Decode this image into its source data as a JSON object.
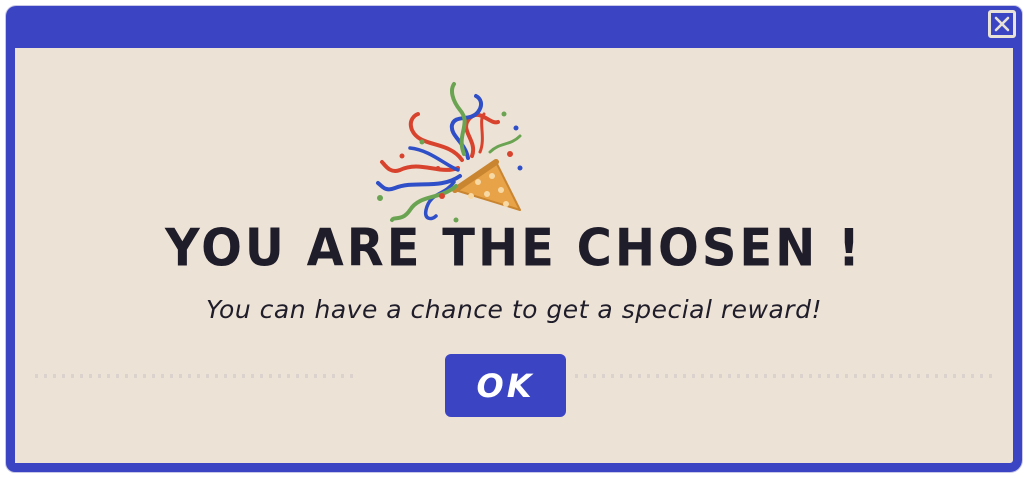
{
  "colors": {
    "frame": "#3b45c4",
    "body_bg": "#ede2d6",
    "ink": "#1f1d2a",
    "confetti_red": "#d8432e",
    "confetti_blue": "#2f4fc8",
    "confetti_green": "#6aa452",
    "popper_orange": "#e8a247"
  },
  "dialog": {
    "close_icon": "close-icon",
    "popper_icon": "party-popper-icon",
    "headline": "YOU ARE THE CHOSEN !",
    "message": "You can have a chance to get a special reward!",
    "ok_label": "OK"
  }
}
